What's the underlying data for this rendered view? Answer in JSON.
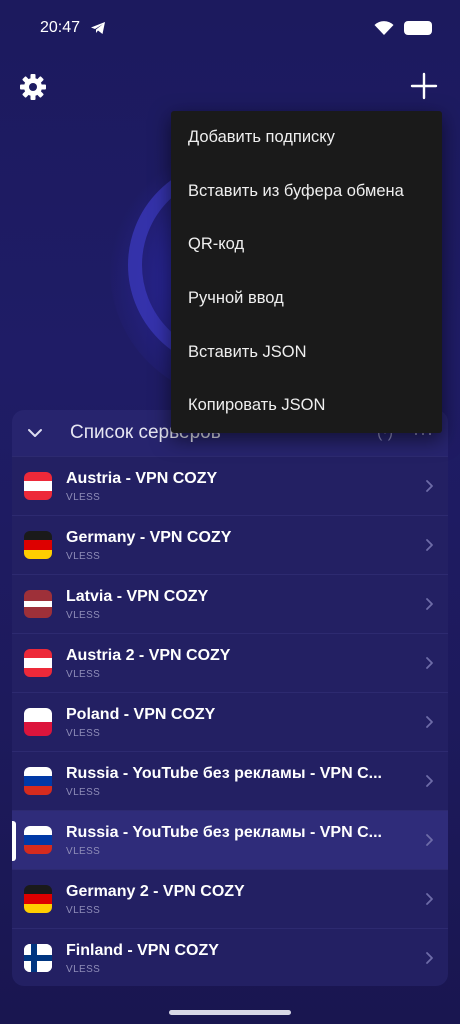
{
  "status_bar": {
    "time": "20:47"
  },
  "menu": {
    "items": [
      "Добавить подписку",
      "Вставить из буфера обмена",
      "QR-код",
      "Ручной ввод",
      "Вставить JSON",
      "Копировать JSON"
    ]
  },
  "panel": {
    "title": "Список серверов",
    "count": "(·)",
    "more": "···"
  },
  "servers": [
    {
      "name": "Austria - VPN COZY",
      "type": "VLESS",
      "flag": "austria"
    },
    {
      "name": "Germany - VPN COZY",
      "type": "VLESS",
      "flag": "germany"
    },
    {
      "name": "Latvia - VPN COZY",
      "type": "VLESS",
      "flag": "latvia"
    },
    {
      "name": "Austria 2 - VPN COZY",
      "type": "VLESS",
      "flag": "austria"
    },
    {
      "name": "Poland - VPN COZY",
      "type": "VLESS",
      "flag": "poland"
    },
    {
      "name": "Russia - YouTube без рекламы - VPN C...",
      "type": "VLESS",
      "flag": "russia"
    },
    {
      "name": "Russia - YouTube без рекламы - VPN C...",
      "type": "VLESS",
      "flag": "russia",
      "selected": true
    },
    {
      "name": "Germany 2 - VPN COZY",
      "type": "VLESS",
      "flag": "germany"
    },
    {
      "name": "Finland - VPN COZY",
      "type": "VLESS",
      "flag": "finland"
    }
  ],
  "colors": {
    "background": "#1c1a5e",
    "panel": "#232063",
    "menu": "#1a1a1a"
  }
}
